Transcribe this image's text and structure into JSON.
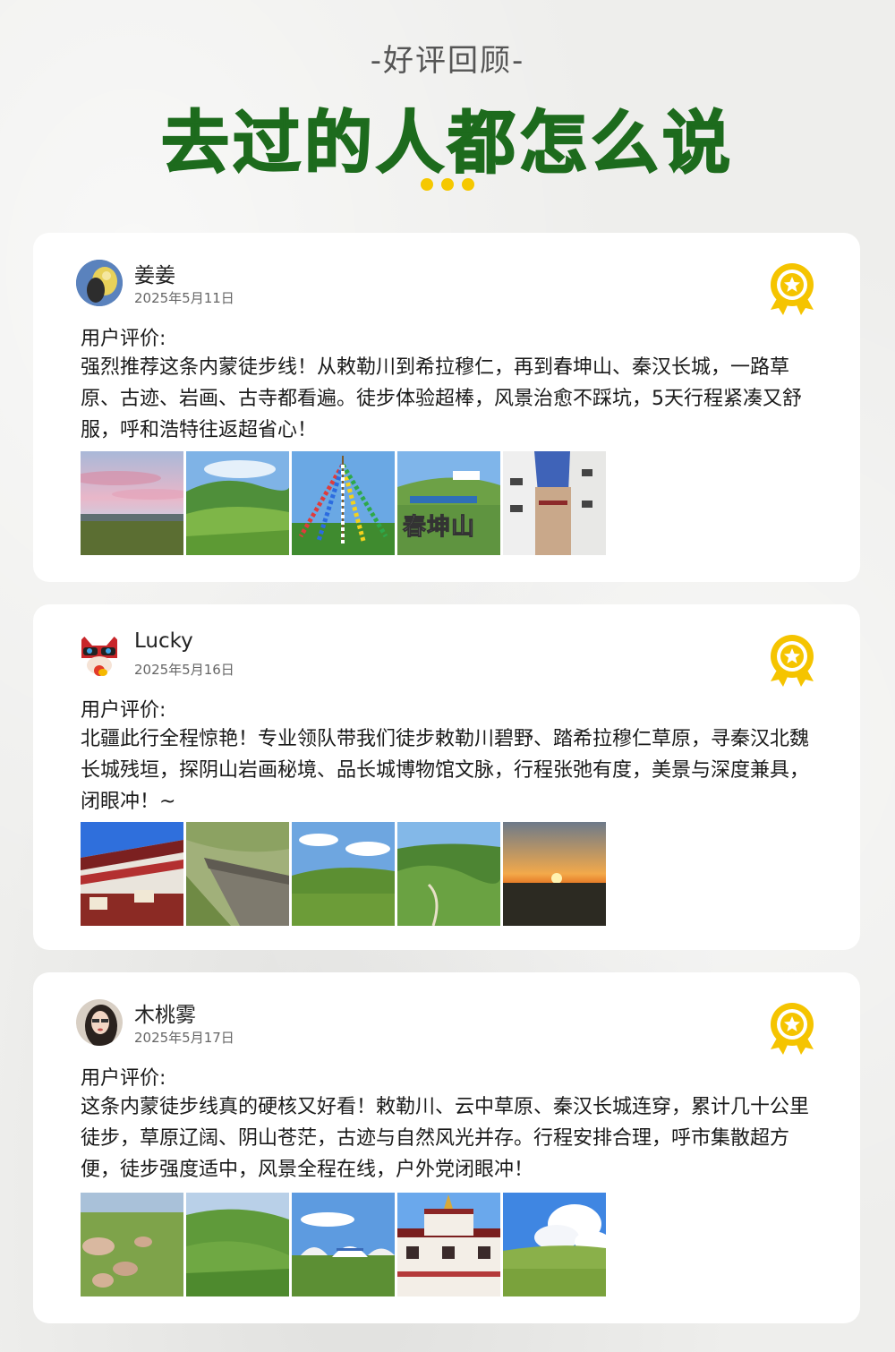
{
  "header": {
    "subtitle": "-好评回顾-",
    "title": "去过的人都怎么说",
    "dot_color": "#f5c800",
    "title_color": "#1d6b1d"
  },
  "reviews": [
    {
      "name": "姜姜",
      "date": "2025年5月11日",
      "label": "用户评价:",
      "text": "强烈推荐这条内蒙徒步线！从敕勒川到希拉穆仁，再到春坤山、秦汉长城，一路草原、古迹、岩画、古寺都看遍。徒步体验超棒，风景治愈不踩坑，5天行程紧凑又舒服，呼和浩特往返超省心！",
      "photo_caption": "春坤山"
    },
    {
      "name": "Lucky",
      "date": "2025年5月16日",
      "label": "用户评价:",
      "text": "北疆此行全程惊艳！专业领队带我们徒步敕勒川碧野、踏希拉穆仁草原，寻秦汉北魏长城残垣，探阴山岩画秘境、品长城博物馆文脉，行程张弛有度，美景与深度兼具，闭眼冲！~"
    },
    {
      "name": "木桃雾",
      "date": "2025年5月17日",
      "label": "用户评价:",
      "text": "这条内蒙徒步线真的硬核又好看！敕勒川、云中草原、秦汉长城连穿，累计几十公里徒步，草原辽阔、阴山苍茫，古迹与自然风光并存。行程安排合理，呼市集散超方便，徒步强度适中，风景全程在线，户外党闭眼冲！"
    }
  ],
  "icons": {
    "medal": "award-medal-icon"
  }
}
